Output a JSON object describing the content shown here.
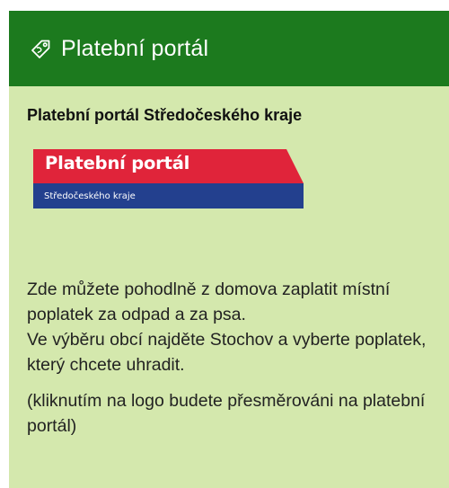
{
  "colors": {
    "header_bg": "#1c7a1e",
    "panel_bg": "#d4e8ad",
    "logo_red": "#e0243a",
    "logo_blue": "#23408e"
  },
  "header": {
    "icon": "tag-icon",
    "title": "Platební portál"
  },
  "body": {
    "title": "Platební portál Středočeského kraje",
    "logo": {
      "main_text": "Platební portál",
      "sub_text": "Středočeského kraje"
    },
    "description": {
      "line1": "Zde můžete pohodlně z domova zaplatit místní poplatek za odpad a za psa.",
      "line2": "Ve výběru obcí najděte Stochov a vyberte poplatek, který chcete uhradit."
    },
    "note": "(kliknutím na logo budete přesměrováni na platební portál)"
  }
}
